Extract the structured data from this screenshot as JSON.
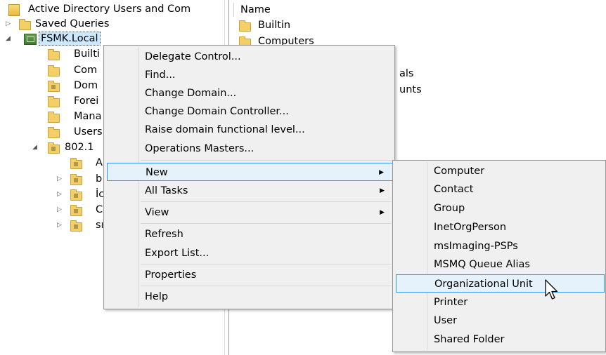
{
  "tree": {
    "root_label": "Active Directory Users and Com",
    "saved_queries": "Saved Queries",
    "domain": "FSMK.Local",
    "children": [
      "Builti",
      "Com",
      "Dom",
      "Forei",
      "Mana",
      "Users",
      "802.1"
    ],
    "sub_children": [
      "A",
      "b",
      "İc",
      "C",
      "sı"
    ]
  },
  "list": {
    "header_name": "Name",
    "rows": [
      "Builtin",
      "Computers",
      "als",
      "unts"
    ]
  },
  "context_menu": {
    "items": [
      "Delegate Control...",
      "Find...",
      "Change Domain...",
      "Change Domain Controller...",
      "Raise domain functional level...",
      "Operations Masters...",
      "New",
      "All Tasks",
      "View",
      "Refresh",
      "Export List...",
      "Properties",
      "Help"
    ],
    "highlighted": "New"
  },
  "submenu": {
    "items": [
      "Computer",
      "Contact",
      "Group",
      "InetOrgPerson",
      "msImaging-PSPs",
      "MSMQ Queue Alias",
      "Organizational Unit",
      "Printer",
      "User",
      "Shared Folder"
    ],
    "highlighted": "Organizational Unit"
  },
  "colors": {
    "highlight_fill": "#e5f1fb",
    "highlight_border": "#3399ff",
    "menu_bg": "#f0f0f0"
  }
}
